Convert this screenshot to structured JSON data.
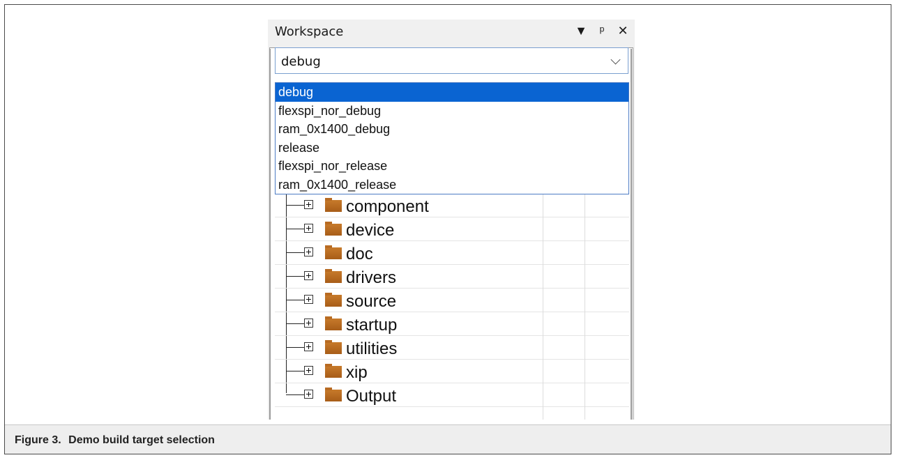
{
  "workspace": {
    "title": "Workspace",
    "header_icons": [
      "dropdown-arrow-icon",
      "pin-icon",
      "close-icon"
    ],
    "config_select": {
      "value": "debug",
      "options": [
        "debug",
        "flexspi_nor_debug",
        "ram_0x1400_debug",
        "release",
        "flexspi_nor_release",
        "ram_0x1400_release"
      ],
      "selected_index": 0
    },
    "tree": {
      "items": [
        "component",
        "device",
        "doc",
        "drivers",
        "source",
        "startup",
        "utilities",
        "xip",
        "Output"
      ]
    }
  },
  "caption": {
    "label": "Figure 3.",
    "text": "Demo build target selection"
  },
  "colors": {
    "selection": "#0a64d2",
    "folder": "#c77a2b",
    "frame": "#4a4a4a",
    "caption_bg": "#eeeeee"
  }
}
